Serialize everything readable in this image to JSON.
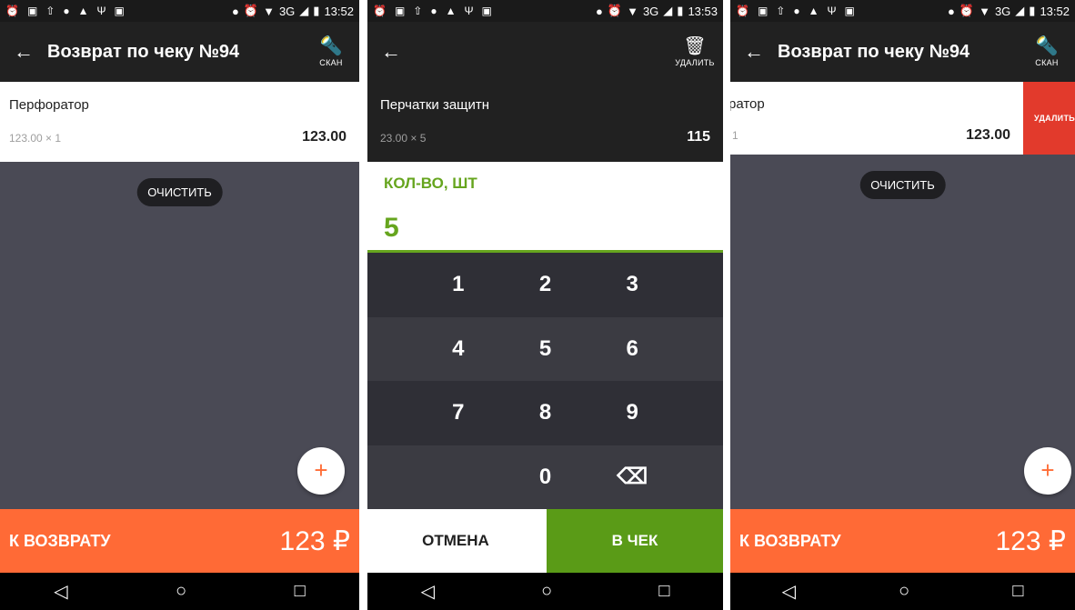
{
  "status": {
    "time_1": "13:52",
    "time_2": "13:53",
    "time_3": "13:52",
    "network": "3G"
  },
  "screen1": {
    "title": "Возврат по чеку №94",
    "scan_label": "СКАН",
    "item": {
      "name": "Перфоратор",
      "qty": "123.00 × 1",
      "sum": "123.00"
    },
    "clear_label": "ОЧИСТИТЬ",
    "fab_label": "+",
    "total_label": "К ВОЗВРАТУ",
    "total_amount": "123 ₽"
  },
  "screen2": {
    "delete_label": "УДАЛИТЬ",
    "item": {
      "name": "Перчатки защитн",
      "qty": "23.00 × 5",
      "sum": "115"
    },
    "field_label": "КОЛ-ВО, ШТ",
    "field_value": "5",
    "keys": [
      "1",
      "2",
      "3",
      "4",
      "5",
      "6",
      "7",
      "8",
      "9",
      "0"
    ],
    "cancel_label": "ОТМЕНА",
    "confirm_label": "В ЧЕК"
  },
  "screen3": {
    "title": "Возврат по чеку №94",
    "scan_label": "СКАН",
    "item": {
      "name": "ратор",
      "qty": "1",
      "sum": "123.00"
    },
    "delete_label": "УДАЛИТЬ",
    "clear_label": "ОЧИСТИТЬ",
    "fab_label": "+",
    "total_label": "К ВОЗВРАТУ",
    "total_amount": "123 ₽"
  },
  "colors": {
    "accent_orange": "#ff6a36",
    "accent_green": "#66a51e",
    "delete_red": "#e23a2c"
  },
  "icons": [
    "alarm-icon",
    "image-icon",
    "upload-icon",
    "android-icon",
    "usb-icon",
    "location-icon",
    "wifi-icon",
    "signal-icon",
    "battery-icon",
    "back-arrow-icon",
    "scanner-icon",
    "trash-icon",
    "backspace-icon",
    "nav-back-icon",
    "nav-home-icon",
    "nav-recents-icon"
  ]
}
